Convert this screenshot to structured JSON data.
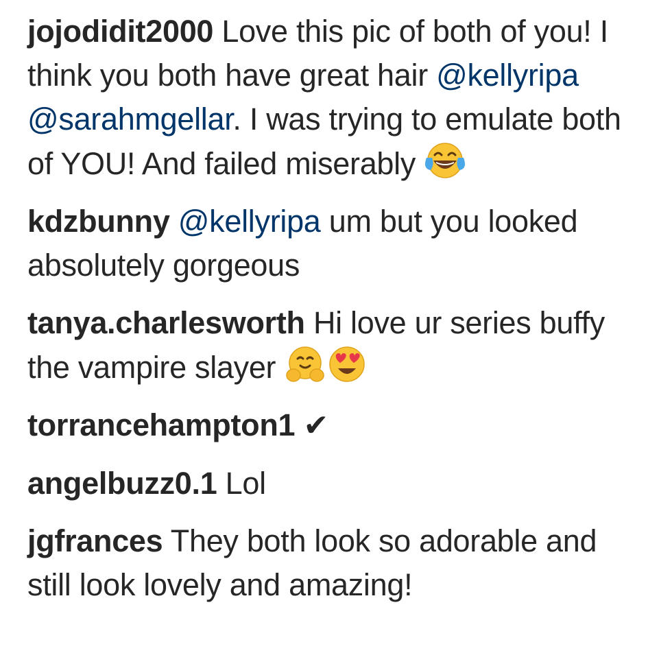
{
  "comments": [
    {
      "username": "jojodidit2000",
      "text_1": " Love this pic of both of you! I think you both have great hair ",
      "mention_1": "@kellyripa",
      "text_2": " ",
      "mention_2": "@sarahmgellar",
      "text_3": ". I was trying to emulate both of YOU! And failed miserably ",
      "emoji": "face-with-tears-of-joy-icon"
    },
    {
      "username": "kdzbunny",
      "text_1": " ",
      "mention_1": "@kellyripa",
      "text_2": " um but you looked absolutely gorgeous"
    },
    {
      "username": "tanya.charlesworth",
      "text_1": " Hi love ur series buffy the vampire slayer ",
      "emojis": [
        "hugging-face-icon",
        "heart-eyes-icon"
      ]
    },
    {
      "username": "torrancehampton1",
      "text_1": " ",
      "check": "✔"
    },
    {
      "username": "angelbuzz0.1",
      "text_1": " Lol"
    },
    {
      "username": "jgfrances",
      "text_1": " They both look so adorable and still look lovely and amazing!"
    }
  ],
  "colors": {
    "text": "#262626",
    "mention": "#003569",
    "emoji_yellow": "#f9c536",
    "emoji_tear": "#4aa8e8"
  }
}
